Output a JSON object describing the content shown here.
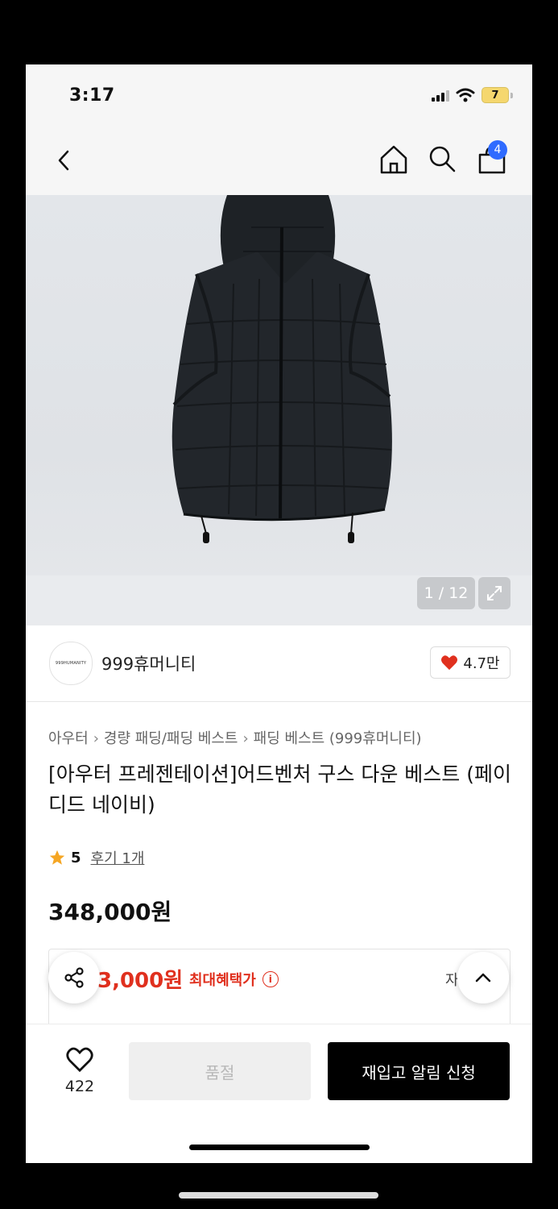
{
  "status": {
    "time": "3:17",
    "battery": "7"
  },
  "nav": {
    "cart_count": "4"
  },
  "gallery": {
    "counter": "1 / 12"
  },
  "brand": {
    "logo_text": "999HUMANITY",
    "name": "999휴머니티",
    "likes": "4.7만"
  },
  "breadcrumb": [
    "아우터",
    "경량 패딩/패딩 베스트",
    "패딩 베스트 (999휴머니티)"
  ],
  "product": {
    "title": "[아우터 프레젠테이션]어드벤처 구스 다운 베스트 (페이디드 네이비)",
    "rating": "5",
    "reviews": "후기 1개",
    "price": "348,000원"
  },
  "benefit": {
    "price": "3,000원",
    "label": "최대혜택가",
    "detail": "자세히"
  },
  "bottom": {
    "wish_count": "422",
    "soldout": "품절",
    "restock": "재입고 알림 신청"
  },
  "colors": {
    "accent_red": "#e0301e",
    "badge_blue": "#2f6bff"
  }
}
